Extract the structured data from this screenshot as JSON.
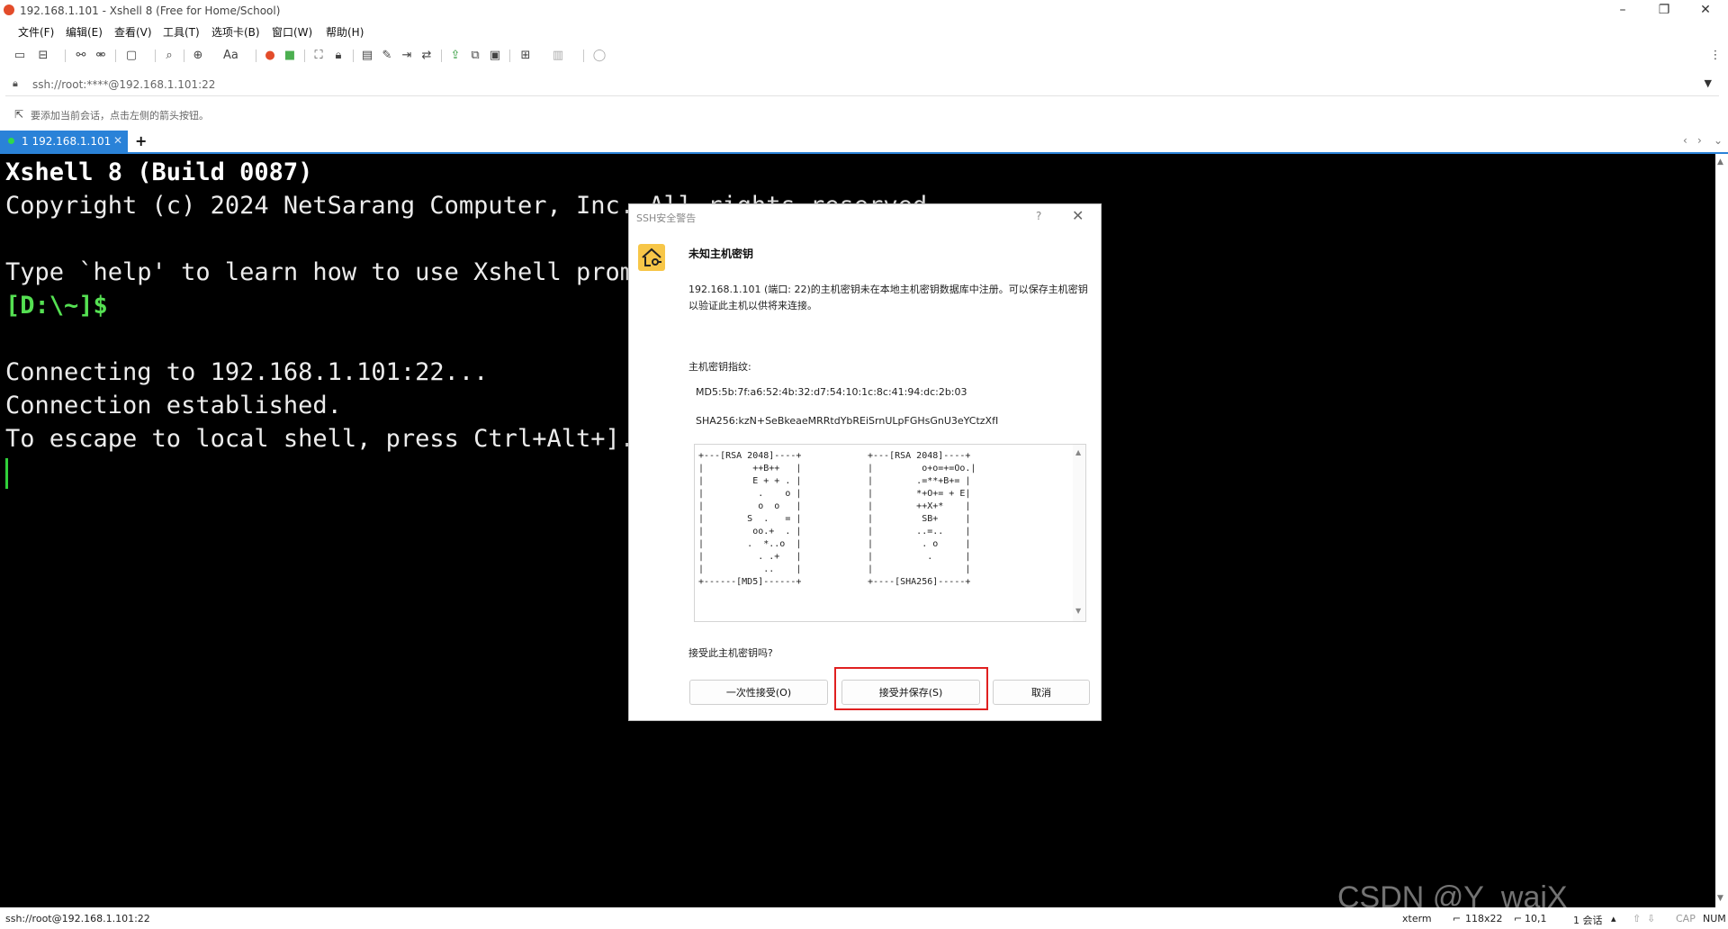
{
  "window": {
    "title": "192.168.1.101 - Xshell 8 (Free for Home/School)",
    "minimize_icon": "minimize-icon",
    "maximize_icon": "restore-icon",
    "close_icon": "close-icon"
  },
  "menu": {
    "items": [
      "文件(F)",
      "编辑(E)",
      "查看(V)",
      "工具(T)",
      "选项卡(B)",
      "窗口(W)",
      "帮助(H)"
    ]
  },
  "toolbar": {
    "icons": [
      "new-session-icon",
      "open-session-icon",
      "connect-icon",
      "disconnect-icon",
      "new-tab-icon",
      "find-icon",
      "globe-icon",
      "font-icon",
      "xftp-icon",
      "xmanager-icon",
      "fullscreen-icon",
      "lock-icon",
      "compose-icon",
      "highlight-icon",
      "script-icon",
      "tunnel-icon",
      "transfer-icon",
      "log-icon",
      "layout-icon",
      "chat-icon"
    ]
  },
  "address": {
    "value": "ssh://root:****@192.168.1.101:22"
  },
  "hint": {
    "text": "要添加当前会话，点击左侧的箭头按钮。"
  },
  "tabs": {
    "items": [
      {
        "label": "1 192.168.1.101",
        "status_color": "#2fd94b"
      }
    ],
    "add_label": "+",
    "prev_label": "‹",
    "next_label": "›",
    "menu_label": "⌄"
  },
  "terminal": {
    "lines": [
      "Xshell 8 (Build 0087)",
      "Copyright (c) 2024 NetSarang Computer, Inc. All rights reserved.",
      "",
      "Type `help' to learn how to use Xshell prompt.",
      "[D:\\~]$",
      "",
      "Connecting to 192.168.1.101:22...",
      "Connection established.",
      "To escape to local shell, press Ctrl+Alt+]."
    ],
    "prompt_color": "#55e052",
    "background": "#000000"
  },
  "watermark": "CSDN @Y_waiX",
  "dialog": {
    "title": "SSH安全警告",
    "help": "?",
    "close": "✕",
    "heading": "未知主机密钥",
    "message": "192.168.1.101 (端口: 22)的主机密钥未在本地主机密钥数据库中注册。可以保存主机密钥以验证此主机以供将来连接。",
    "fingerprint_label": "主机密钥指纹:",
    "md5": "MD5:5b:7f:a6:52:4b:32:d7:54:10:1c:8c:41:94:dc:2b:03",
    "sha256": "SHA256:kzN+SeBkeaeMRRtdYbREiSrnULpFGHsGnU3eYCtzXfI",
    "randomart_md5": "+---[RSA 2048]----+\n|         ++B++   |\n|         E + + . |\n|          .    o |\n|          o  o   |\n|        S  .   = |\n|         oo.+  . |\n|        .  *..o  |\n|          . .+   |\n|           ..    |\n+------[MD5]------+",
    "randomart_sha256": "+---[RSA 2048]----+\n|         o+o=+=Oo.|\n|        .=**+B+= |\n|        *+O+= + E|\n|        ++X+*    |\n|         SB+     |\n|        ..=..    |\n|         . o     |\n|          .      |\n|                 |\n+----[SHA256]-----+",
    "question": "接受此主机密钥吗?",
    "buttons": {
      "once": "一次性接受(O)",
      "save": "接受并保存(S)",
      "cancel": "取消"
    },
    "highlight_color": "#e02020"
  },
  "status": {
    "connection": "ssh://root@192.168.1.101:22",
    "terminal_type": "xterm",
    "size": "118x22",
    "cursor_pos": "10,1",
    "sessions": "1 会话",
    "caps": "CAP",
    "num": "NUM"
  },
  "colors": {
    "accent": "#2a82d8",
    "terminal_bg": "#000000",
    "prompt_green": "#55e052"
  }
}
